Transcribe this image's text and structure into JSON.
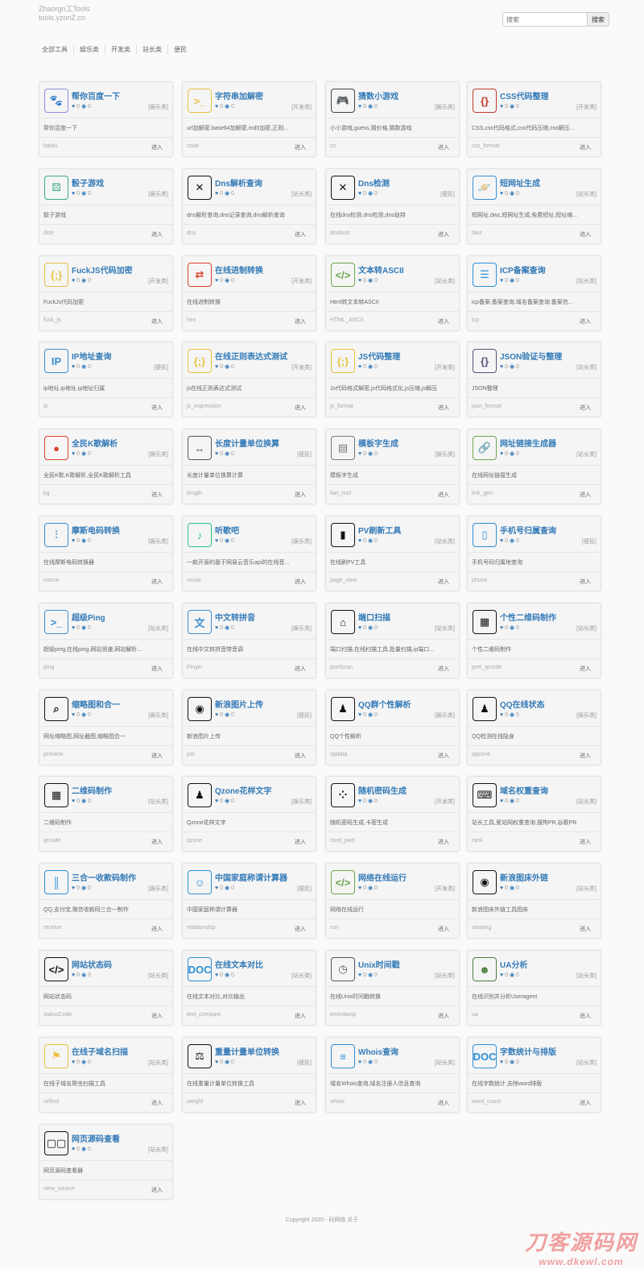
{
  "header": {
    "line1": "Zhaorgn工Tools",
    "line2": "tools.yzonZ.cn"
  },
  "search": {
    "placeholder": "搜索",
    "button": "搜索"
  },
  "nav": [
    "全部工具",
    "娱乐类",
    "开发类",
    "站长类",
    "便民"
  ],
  "cards": [
    {
      "title": "帮你百度一下",
      "tag": "[娱乐类]",
      "desc": "帮你百度一下",
      "slug": "baidu",
      "icon": "paw-icon",
      "color": "#8a8fe0"
    },
    {
      "title": "字符串加解密",
      "tag": "[开发类]",
      "desc": "url加解密,base64加解密,md5加密,正则...",
      "slug": "code",
      "icon": "terminal-icon",
      "color": "#e8c341"
    },
    {
      "title": "猜数小游戏",
      "tag": "[娱乐类]",
      "desc": "小小游戏,guess,猜价格,猜数游戏",
      "slug": "cs",
      "icon": "gamepad-icon",
      "color": "#444444"
    },
    {
      "title": "CSS代码整理",
      "tag": "[开发类]",
      "desc": "CSS,css代码格式,css代码压缩,css解压...",
      "slug": "css_format",
      "icon": "css-file-icon",
      "color": "#c0392b"
    },
    {
      "title": "骰子游戏",
      "tag": "[娱乐类]",
      "desc": "骰子游戏",
      "slug": "dice",
      "icon": "dice-icon",
      "color": "#3aab8a"
    },
    {
      "title": "Dns解析查询",
      "tag": "[站长类]",
      "desc": "dns解析查询,dns记录查询,dns解析查询",
      "slug": "dns",
      "icon": "dns-icon",
      "color": "#111111"
    },
    {
      "title": "Dns检测",
      "tag": "[便民]",
      "desc": "在线dns检测,dns检测,dns劫持",
      "slug": "dnsbest",
      "icon": "dns-check-icon",
      "color": "#111111"
    },
    {
      "title": "短网址生成",
      "tag": "[站长类]",
      "desc": "短网址,dwz,短网址生成,免费短址,短址缩...",
      "slug": "dwz",
      "icon": "planet-icon",
      "color": "#3b8ed0"
    },
    {
      "title": "FuckJS代码加密",
      "tag": "[开发类]",
      "desc": "FuckJs代码加密",
      "slug": "fuck_js",
      "icon": "js-file-icon",
      "color": "#e8c341"
    },
    {
      "title": "在线进制转换",
      "tag": "[开发类]",
      "desc": "在线进制转换",
      "slug": "hex",
      "icon": "convert-icon",
      "color": "#d9412e"
    },
    {
      "title": "文本转ASCII",
      "tag": "[站长类]",
      "desc": "Html转文本转ASCII",
      "slug": "HTML_ASCII",
      "icon": "code-file-icon",
      "color": "#6aa84f"
    },
    {
      "title": "ICP备案查询",
      "tag": "[站长类]",
      "desc": "icp备案,备案查询,域名备案查询,备案信...",
      "slug": "icp",
      "icon": "folder-list-icon",
      "color": "#2d8fd5"
    },
    {
      "title": "IP地址查询",
      "tag": "[便民]",
      "desc": "ip地址,ip地址,ip地址归属",
      "slug": "ip",
      "icon": "monitor-ip-icon",
      "color": "#3b8ed0"
    },
    {
      "title": "在线正则表达式测试",
      "tag": "[开发类]",
      "desc": "js在线正则表达式测试",
      "slug": "js_expression",
      "icon": "regex-file-icon",
      "color": "#e8c341"
    },
    {
      "title": "JS代码整理",
      "tag": "[开发类]",
      "desc": "Js代码格式解密,js代码格式化,js压缩,js解压",
      "slug": "js_format",
      "icon": "js-format-icon",
      "color": "#e8c341"
    },
    {
      "title": "JSON验证与整理",
      "tag": "[站长类]",
      "desc": "JSON整理",
      "slug": "json_format",
      "icon": "json-icon",
      "color": "#555577"
    },
    {
      "title": "全民K歌解析",
      "tag": "[娱乐类]",
      "desc": "全民K歌,K歌解析,全民K歌解析工具",
      "slug": "kg",
      "icon": "bird-icon",
      "color": "#d9412e"
    },
    {
      "title": "长度计量单位换算",
      "tag": "[便民]",
      "desc": "长度计量单位换算计算",
      "slug": "length",
      "icon": "ruler-icon",
      "color": "#555555"
    },
    {
      "title": "模板字生成",
      "tag": "[娱乐类]",
      "desc": "模板字生成",
      "slug": "lian_tool",
      "icon": "pages-icon",
      "color": "#777777"
    },
    {
      "title": "网址链接生成器",
      "tag": "[站长类]",
      "desc": "在线网址链接生成",
      "slug": "link_gen",
      "icon": "link-file-icon",
      "color": "#6aa84f"
    },
    {
      "title": "摩斯电码转换",
      "tag": "[娱乐类]",
      "desc": "在线摩斯电码转换器",
      "slug": "morse",
      "icon": "morse-icon",
      "color": "#3b8ed0"
    },
    {
      "title": "听歌吧",
      "tag": "[娱乐类]",
      "desc": "一款开源的基于网易云音乐api的在线音...",
      "slug": "music",
      "icon": "music-icon",
      "color": "#2ec27e"
    },
    {
      "title": "PV刷新工具",
      "tag": "[站长类]",
      "desc": "在线刷PV工具",
      "slug": "page_view",
      "icon": "bar-chart-icon",
      "color": "#111111"
    },
    {
      "title": "手机号归属查询",
      "tag": "[便民]",
      "desc": "手机号码归属地查询",
      "slug": "phone",
      "icon": "phone-icon",
      "color": "#2d8fd5"
    },
    {
      "title": "超级Ping",
      "tag": "[站长类]",
      "desc": "超级ping,在线ping,网站测速,网站解析...",
      "slug": "ping",
      "icon": "ping-icon",
      "color": "#3b8ed0"
    },
    {
      "title": "中文转拼音",
      "tag": "[娱乐类]",
      "desc": "在线中文转拼音带音调",
      "slug": "Pinyin",
      "icon": "pinyin-icon",
      "color": "#3b8ed0"
    },
    {
      "title": "端口扫描",
      "tag": "[站长类]",
      "desc": "端口扫描,在线扫描工具,批量扫描,ip端口...",
      "slug": "portScan",
      "icon": "port-scan-icon",
      "color": "#111111"
    },
    {
      "title": "个性二维码制作",
      "tag": "[站长类]",
      "desc": "个性二维码制作",
      "slug": "pret_qrcode",
      "icon": "qrcode-icon",
      "color": "#111111"
    },
    {
      "title": "缩略图和合一",
      "tag": "[娱乐类]",
      "desc": "网址缩略图,网址截图,缩略图合一",
      "slug": "preview",
      "icon": "magnifier-icon",
      "color": "#111111"
    },
    {
      "title": "新浪图片上传",
      "tag": "[便民]",
      "desc": "新浪图片上传",
      "slug": "pst",
      "icon": "weibo-icon",
      "color": "#111111"
    },
    {
      "title": "QQ群个性解析",
      "tag": "[娱乐类]",
      "desc": "QQ个性解析",
      "slug": "qqdata",
      "icon": "penguin-icon",
      "color": "#111111"
    },
    {
      "title": "QQ在线状态",
      "tag": "[娱乐类]",
      "desc": "QQ检测在线隐身",
      "slug": "qqzone",
      "icon": "penguin-icon",
      "color": "#111111"
    },
    {
      "title": "二维码制作",
      "tag": "[站长类]",
      "desc": "二维码制作",
      "slug": "qrcode",
      "icon": "qrcode-icon",
      "color": "#111111"
    },
    {
      "title": "Qzone花样文字",
      "tag": "[娱乐类]",
      "desc": "Qzone花样文字",
      "slug": "qzone",
      "icon": "penguin-icon",
      "color": "#111111"
    },
    {
      "title": "随机密码生成",
      "tag": "[开发类]",
      "desc": "随机密码生成,卡密生成",
      "slug": "rand_pwd",
      "icon": "dots-grid-icon",
      "color": "#111111"
    },
    {
      "title": "域名权重查询",
      "tag": "[站长类]",
      "desc": "站长工具,爱站网权重查询,搜狗PR,谷歌PR",
      "slug": "rank",
      "icon": "keyboard-icon",
      "color": "#111111"
    },
    {
      "title": "三合一收款码制作",
      "tag": "[娱乐类]",
      "desc": "QQ,支付宝,微信收款码三合一制作",
      "slug": "receive",
      "icon": "barcode-icon",
      "color": "#2d8fd5"
    },
    {
      "title": "中国家庭称谓计算器",
      "tag": "[便民]",
      "desc": "中国家庭称谓计算器",
      "slug": "relationship",
      "icon": "person-icon",
      "color": "#2d8fd5"
    },
    {
      "title": "网络在线运行",
      "tag": "[开发类]",
      "desc": "网络在线运行",
      "slug": "run",
      "icon": "run-file-icon",
      "color": "#6aa84f"
    },
    {
      "title": "新浪图床外链",
      "tag": "[站长类]",
      "desc": "新浪图床外链工具图床",
      "slug": "sinaimg",
      "icon": "weibo-icon",
      "color": "#111111"
    },
    {
      "title": "网站状态码",
      "tag": "[站长类]",
      "desc": "网站状态码",
      "slug": "statusCode",
      "icon": "code-tag-icon",
      "color": "#111111"
    },
    {
      "title": "在线文本对比",
      "tag": "[站长类]",
      "desc": "在线文本对比,对比输出",
      "slug": "text_compare",
      "icon": "doc-icon",
      "color": "#2d8fd5"
    },
    {
      "title": "Unix时间戳",
      "tag": "[站长类]",
      "desc": "在线Unix时间戳转换",
      "slug": "timestamp",
      "icon": "clock-icon",
      "color": "#555555"
    },
    {
      "title": "UA分析",
      "tag": "[站长类]",
      "desc": "在线识别并分析Useragent",
      "slug": "ua",
      "icon": "avatar-icon",
      "color": "#4a7f3d"
    },
    {
      "title": "在线子域名扫描",
      "tag": "[站长类]",
      "desc": "在线子域名爬虫扫描工具",
      "slug": "urlfind",
      "icon": "signpost-icon",
      "color": "#e8c341"
    },
    {
      "title": "重量计量单位转换",
      "tag": "[便民]",
      "desc": "在线重量计量单位转换工具",
      "slug": "weight",
      "icon": "weight-icon",
      "color": "#111111"
    },
    {
      "title": "Whois查询",
      "tag": "[站长类]",
      "desc": "域名Whois查询,域名注册人信息查询",
      "slug": "whois",
      "icon": "list-card-icon",
      "color": "#2d8fd5"
    },
    {
      "title": "字数统计与排版",
      "tag": "[站长类]",
      "desc": "在线字数统计,去除word排版",
      "slug": "word_count",
      "icon": "doc-icon",
      "color": "#2d8fd5"
    },
    {
      "title": "网页源码查看",
      "tag": "[站长类]",
      "desc": "网页源码查看器",
      "slug": "view_source",
      "icon": "windows-icon",
      "color": "#111111"
    }
  ],
  "card_stats": {
    "likes": "0",
    "views": "0"
  },
  "card_enter": "进入",
  "footer": "Copyright 2020 - 码网络 关于",
  "watermark": {
    "line1": "刀客源码网",
    "line2": "www.dkewl.com"
  }
}
